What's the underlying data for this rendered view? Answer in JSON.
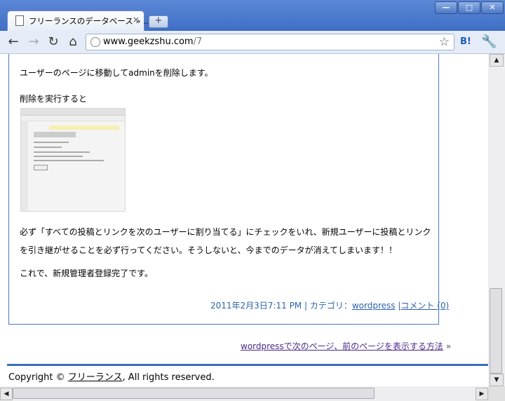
{
  "browser": {
    "tab_title": "フリーランスのデータベース » …",
    "tab_close": "×",
    "new_tab": "+",
    "url_domain": "www.geekzshu.com",
    "url_path": "/7",
    "hatena_label": "B!",
    "window_buttons": {
      "minimize": "—",
      "maximize": "□",
      "close": "✕"
    }
  },
  "post": {
    "paragraph1": "ユーザーのページに移動してadminを削除します。",
    "paragraph2": "削除を実行すると",
    "paragraph3": "必ず「すべての投稿とリンクを次のユーザーに割り当てる」にチェックをいれ、新規ユーザーに投稿とリンクを引き継がせることを必ず行ってください。そうしないと、今までのデータが消えてしまいます！！",
    "paragraph4": "これで、新規管理者登録完了です。",
    "meta_date": "2011年2月3日7:11 PM | カテゴリ：",
    "meta_category": "wordpress",
    "meta_sep": " |",
    "meta_comments": "コメント (0)"
  },
  "navigation": {
    "next_link": "wordpressで次のページ、前のページを表示する方法",
    "next_arrow": "»"
  },
  "footer": {
    "copyright_prefix": "Copyright © ",
    "site_link": "フリーランス",
    "copyright_suffix": ", All rights reserved."
  },
  "icons": [
    "document-icon",
    "back-icon",
    "forward-icon",
    "reload-icon",
    "home-icon",
    "globe-icon",
    "star-icon",
    "wrench-icon"
  ]
}
